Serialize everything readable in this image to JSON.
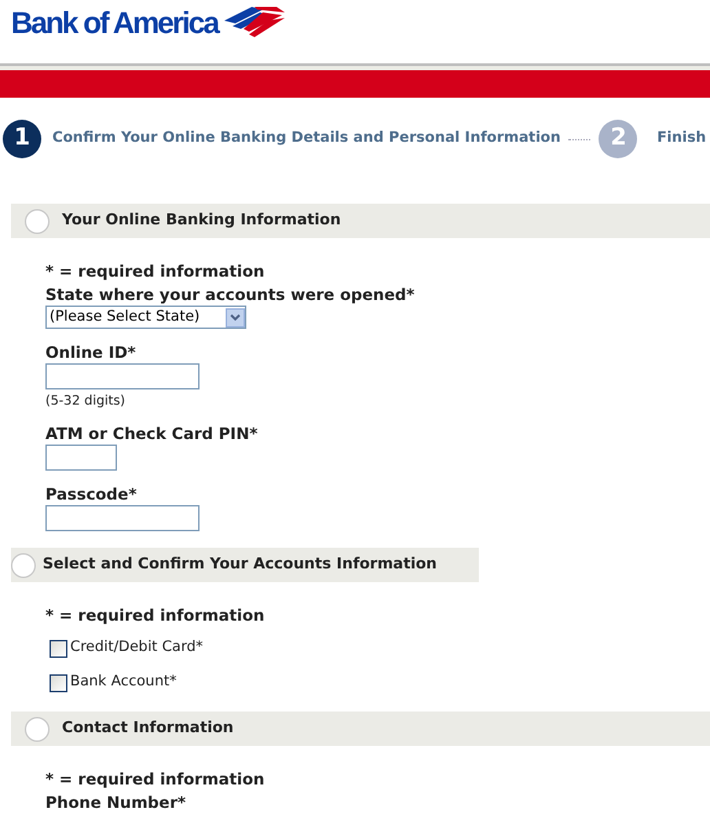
{
  "logo": {
    "text": "Bank of America"
  },
  "steps": [
    {
      "number": "1",
      "label": "Confirm Your Online Banking Details and Personal Information",
      "selected": true
    },
    {
      "number": "2",
      "label": "Finish",
      "selected": false
    }
  ],
  "sections": [
    {
      "title": "Your Online Banking Information",
      "full_width": true,
      "fields": [
        {
          "kind": "note",
          "label": "* = required information"
        },
        {
          "kind": "select",
          "label": "State where your accounts were opened*",
          "value": "(Please Select State)"
        },
        {
          "kind": "text",
          "label": "Online ID*",
          "hint": "(5-32 digits)"
        },
        {
          "kind": "short_text",
          "label": "ATM or Check Card PIN*"
        },
        {
          "kind": "text",
          "label": "Passcode*"
        }
      ]
    },
    {
      "title": "Select and Confirm Your Accounts Information",
      "full_width": false,
      "fields": [
        {
          "kind": "note",
          "label": "* = required information"
        },
        {
          "kind": "checkbox",
          "label": "Credit/Debit Card*",
          "checked": false
        },
        {
          "kind": "checkbox",
          "label": "Bank Account*",
          "checked": false
        }
      ]
    },
    {
      "title": "Contact Information",
      "full_width": true,
      "fields": [
        {
          "kind": "note",
          "label": "* = required information"
        },
        {
          "kind": "label",
          "label": "Phone Number*"
        }
      ]
    }
  ]
}
